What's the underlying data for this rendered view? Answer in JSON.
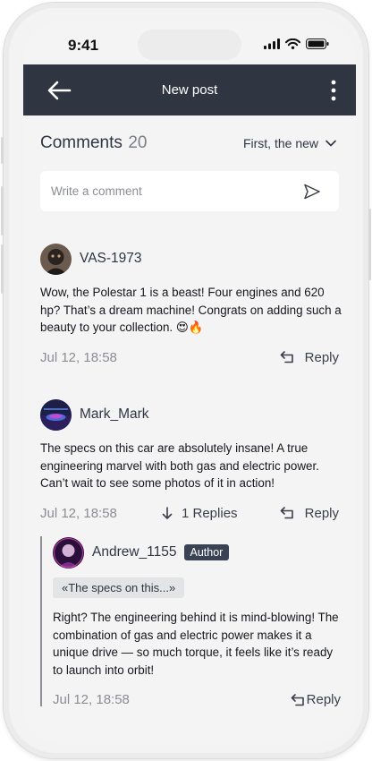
{
  "status_bar": {
    "time": "9:41"
  },
  "header": {
    "title": "New post"
  },
  "comments": {
    "title": "Comments",
    "count": "20",
    "sort_label": "First, the new",
    "input_placeholder": "Write a comment",
    "items": [
      {
        "username": "VAS-1973",
        "text": "Wow, the Polestar 1 is a beast! Four engines and 620 hp? That’s a dream machine! Congrats on adding such a beauty to your collection. 😍🔥",
        "date": "Jul 12, 18:58",
        "reply_label": "Reply"
      },
      {
        "username": "Mark_Mark",
        "text": "The specs on this car are absolutely insane! A true engineering marvel with both gas and electric power. Can’t wait to see some photos of it in action!",
        "date": "Jul 12, 18:58",
        "replies_label": "1 Replies",
        "reply_label": "Reply"
      }
    ],
    "reply": {
      "username": "Andrew_1155",
      "badge": "Author",
      "quote": "«The specs on this...»",
      "text": "Right? The engineering behind it is mind-blowing! The combination of gas and electric power makes it a unique drive — so much torque, it feels like it’s ready to launch into orbit!",
      "date": "Jul 12, 18:58",
      "reply_label": "Reply"
    }
  },
  "colors": {
    "header_bg": "#2f3541",
    "badge_bg": "#3a4354",
    "screen_bg": "#f4f4f5"
  }
}
